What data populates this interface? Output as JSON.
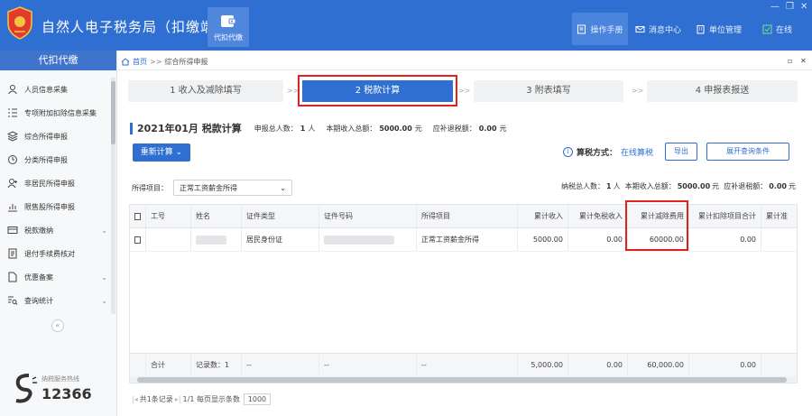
{
  "app": {
    "title": "自然人电子税务局（扣缴端）",
    "module_tile_label": "代扣代缴",
    "accent_color": "#2f6fd1",
    "highlight_color": "#e0221c"
  },
  "top_menu": {
    "manual": "操作手册",
    "messages": "消息中心",
    "unit": "单位管理",
    "online": "在线"
  },
  "sidebar": {
    "header": "代扣代缴",
    "items": [
      {
        "label": "人员信息采集",
        "icon": "person-icon",
        "has_children": false
      },
      {
        "label": "专项附加扣除信息采集",
        "icon": "list-icon",
        "has_children": false
      },
      {
        "label": "综合所得申报",
        "icon": "layers-icon",
        "has_children": false
      },
      {
        "label": "分类所得申报",
        "icon": "clock-icon",
        "has_children": false
      },
      {
        "label": "非居民所得申报",
        "icon": "person-plus-icon",
        "has_children": false
      },
      {
        "label": "限售股所得申报",
        "icon": "chart-icon",
        "has_children": false
      },
      {
        "label": "税款缴纳",
        "icon": "card-icon",
        "has_children": true
      },
      {
        "label": "退付手续费核对",
        "icon": "document-icon",
        "has_children": false
      },
      {
        "label": "优惠备案",
        "icon": "file-icon",
        "has_children": true
      },
      {
        "label": "查询统计",
        "icon": "search-list-icon",
        "has_children": true
      }
    ],
    "collapse_glyph": "«",
    "hotline_label": "纳税服务热线",
    "hotline_number": "12366"
  },
  "breadcrumb": {
    "home": "首页",
    "separator": ">>",
    "current": "综合所得申报"
  },
  "steps": [
    {
      "label": "1 收入及减除填写",
      "active": false
    },
    {
      "label": "2 税款计算",
      "active": true
    },
    {
      "label": "3 附表填写",
      "active": false
    },
    {
      "label": "4 申报表报送",
      "active": false
    }
  ],
  "step_separator": ">>",
  "summary": {
    "period": "2021年01月",
    "title": "税款计算",
    "declare_count_label": "申报总人数：",
    "declare_count": "1",
    "person_unit": "人",
    "income_label": "本期收入总额：",
    "income": "5000.00",
    "currency_unit": "元",
    "refund_label": "应补退税额：",
    "refund": "0.00"
  },
  "actions": {
    "recalc": "重新计算",
    "calc_mode_label": "算税方式：",
    "calc_mode_value": "在线算税",
    "export": "导出",
    "expand_filters": "展开查询条件"
  },
  "filter": {
    "label": "所得项目：",
    "value": "正常工资薪金所得"
  },
  "stats_right": {
    "taxpayers_label": "纳税总人数：",
    "taxpayers": "1",
    "person_unit": "人",
    "income_label": "本期收入总额：",
    "income": "5000.00",
    "currency_unit": "元",
    "refund_label": "应补退税额：",
    "refund": "0.00",
    "refund_unit": "元"
  },
  "table": {
    "columns": [
      "工号",
      "姓名",
      "证件类型",
      "证件号码",
      "所得项目",
      "累计收入",
      "累计免税收入",
      "累计减除费用",
      "累计扣除项目合计",
      "累计准"
    ],
    "rows": [
      {
        "employee_no": "",
        "name": "",
        "id_type": "居民身份证",
        "id_number": "",
        "income_item": "正常工资薪金所得",
        "cum_income": "5000.00",
        "cum_tax_free": "0.00",
        "cum_deduction": "60000.00",
        "cum_deduct_total": "0.00"
      }
    ],
    "footer": {
      "total_label": "合计",
      "record_count": "记录数：1",
      "dash": "--",
      "cum_income": "5,000.00",
      "cum_tax_free": "0.00",
      "cum_deduction": "60,000.00",
      "cum_deduct_total": "0.00"
    }
  },
  "pager": {
    "summary": "共1条记录",
    "page": "1/1",
    "per_page_label": "每页显示条数",
    "per_page": "1000"
  }
}
